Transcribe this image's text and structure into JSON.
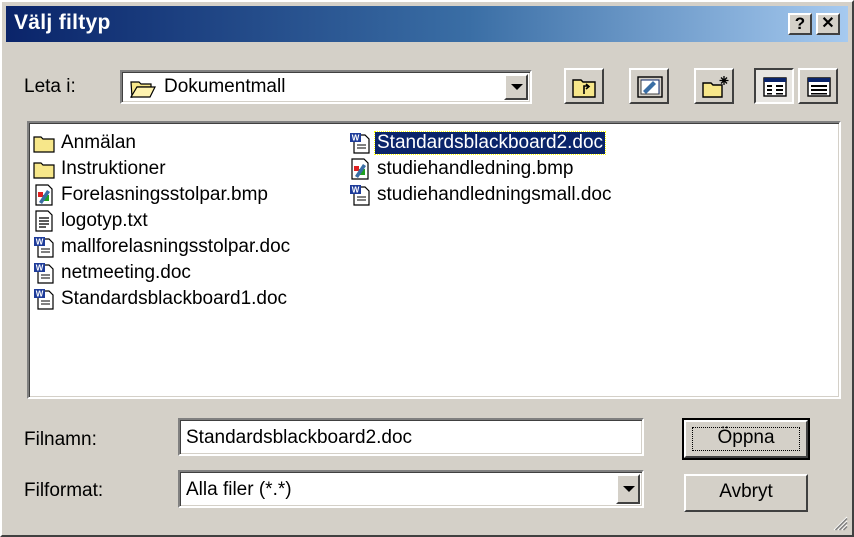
{
  "window": {
    "title": "Välj filtyp"
  },
  "title_buttons": {
    "help": "?",
    "close": "✕"
  },
  "look_in": {
    "label": "Leta i:",
    "value": "Dokumentmall"
  },
  "toolbar": {
    "icons": [
      "up-one-level-icon",
      "desktop-icon",
      "new-folder-icon",
      "list-view-icon",
      "details-view-icon"
    ]
  },
  "files": [
    {
      "name": "Anmälan",
      "type": "folder"
    },
    {
      "name": "Instruktioner",
      "type": "folder"
    },
    {
      "name": "Forelasningsstolpar.bmp",
      "type": "bmp"
    },
    {
      "name": "logotyp.txt",
      "type": "txt"
    },
    {
      "name": "mallforelasningsstolpar.doc",
      "type": "doc"
    },
    {
      "name": "netmeeting.doc",
      "type": "doc"
    },
    {
      "name": "Standardsblackboard1.doc",
      "type": "doc"
    },
    {
      "name": "Standardsblackboard2.doc",
      "type": "doc",
      "selected": true
    },
    {
      "name": "studiehandledning.bmp",
      "type": "bmp"
    },
    {
      "name": "studiehandledningsmall.doc",
      "type": "doc"
    }
  ],
  "filename": {
    "label": "Filnamn:",
    "value": "Standardsblackboard2.doc"
  },
  "filetype": {
    "label": "Filformat:",
    "value": "Alla filer (*.*)"
  },
  "buttons": {
    "open": "Öppna",
    "cancel": "Avbryt"
  },
  "colors": {
    "title_start": "#0a246a",
    "title_end": "#a6caf0",
    "face": "#d4d0c8",
    "selection": "#0a246a"
  }
}
